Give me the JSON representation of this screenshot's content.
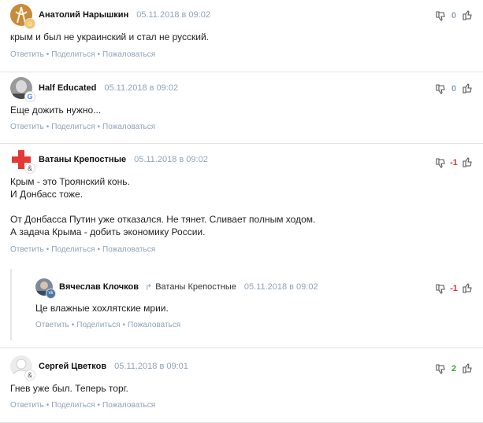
{
  "actions": {
    "reply": "Ответить",
    "share": "Поделиться",
    "report": "Пожаловаться",
    "sep": "•"
  },
  "comments": [
    {
      "author": "Анатолий Нарышкин",
      "date": "05.11.2018 в 09:02",
      "rating": "0",
      "text": [
        "крым и был не украинский и стал не русский."
      ]
    },
    {
      "author": "Half Educated",
      "date": "05.11.2018 в 09:02",
      "rating": "0",
      "text": [
        "Еще дожить нужно..."
      ]
    },
    {
      "author": "Ватаны Крепостные",
      "date": "05.11.2018 в 09:02",
      "rating": "-1",
      "text": [
        "Крым - это Троянский конь.",
        "И Донбасс тоже.",
        "От Донбасса Путин уже отказался. Не тянет. Сливает полным ходом.",
        "А задача Крыма - добить экономику России."
      ]
    },
    {
      "author": "Вячеслав Клочков",
      "reply_to": "Ватаны Крепостные",
      "date": "05.11.2018 в 09:02",
      "rating": "-1",
      "text": [
        "Це влажные хохлятские мрии."
      ]
    },
    {
      "author": "Сергей Цветков",
      "date": "05.11.2018 в 09:01",
      "rating": "2",
      "text": [
        "Гнев уже был. Теперь торг."
      ]
    }
  ],
  "colors": {
    "meta": "#8fa4b8",
    "negative": "#d6383c",
    "positive": "#3fa83a"
  },
  "icons": [
    "thumb-down-icon",
    "thumb-up-icon",
    "reply-arrow-icon"
  ]
}
